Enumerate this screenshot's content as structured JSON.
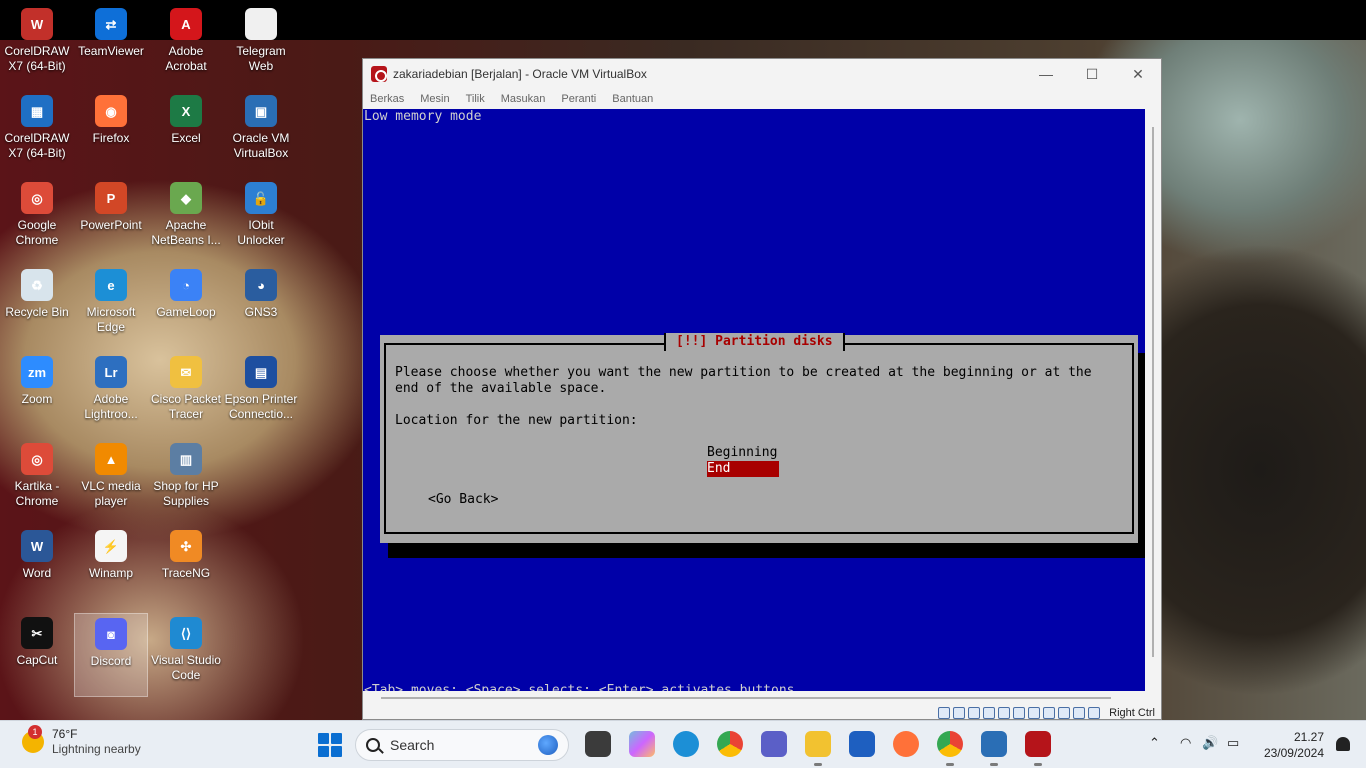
{
  "desktop": {
    "icons": [
      {
        "label": "CorelDRAW\nX7 (64-Bit)",
        "color": "#c2302a",
        "glyph": "W"
      },
      {
        "label": "TeamViewer",
        "color": "#0e6fd8",
        "glyph": "⇄"
      },
      {
        "label": "Adobe\nAcrobat",
        "color": "#d4161b",
        "glyph": "A"
      },
      {
        "label": "Telegram\nWeb",
        "color": "#f0f0f0",
        "glyph": ""
      },
      {
        "label": "CorelDRAW\nX7 (64-Bit)",
        "color": "#1f6fc4",
        "glyph": "▦"
      },
      {
        "label": "Firefox",
        "color": "#ff7139",
        "glyph": "◉"
      },
      {
        "label": "Excel",
        "color": "#1d7a45",
        "glyph": "X"
      },
      {
        "label": "Oracle VM\nVirtualBox",
        "color": "#2a6eb5",
        "glyph": "▣"
      },
      {
        "label": "Google\nChrome",
        "color": "#dd4b39",
        "glyph": "◎"
      },
      {
        "label": "PowerPoint",
        "color": "#d24726",
        "glyph": "P"
      },
      {
        "label": "Apache\nNetBeans I...",
        "color": "#6aa84f",
        "glyph": "◆"
      },
      {
        "label": "IObit\nUnlocker",
        "color": "#2d7fd3",
        "glyph": "🔓"
      },
      {
        "label": "Recycle Bin",
        "color": "#d8e4ec",
        "glyph": "♻"
      },
      {
        "label": "Microsoft\nEdge",
        "color": "#1c8fd6",
        "glyph": "e"
      },
      {
        "label": "GameLoop",
        "color": "#3b82f6",
        "glyph": "◔"
      },
      {
        "label": "GNS3",
        "color": "#2a5d9f",
        "glyph": "◕"
      },
      {
        "label": "Zoom",
        "color": "#2d8cff",
        "glyph": "zm"
      },
      {
        "label": "Adobe\nLightroo...",
        "color": "#2d6fc0",
        "glyph": "Lr"
      },
      {
        "label": "Cisco Packet\nTracer",
        "color": "#f0c040",
        "glyph": "✉"
      },
      {
        "label": "Epson Printer\nConnectio...",
        "color": "#1d4fa0",
        "glyph": "▤"
      },
      {
        "label": "Kartika -\nChrome",
        "color": "#dd4b39",
        "glyph": "◎"
      },
      {
        "label": "VLC media\nplayer",
        "color": "#f18a00",
        "glyph": "▲"
      },
      {
        "label": "Shop for HP\nSupplies",
        "color": "#5c7ea3",
        "glyph": "▥"
      },
      {
        "label": "",
        "color": "#000000",
        "glyph": ""
      },
      {
        "label": "Word",
        "color": "#2b5797",
        "glyph": "W"
      },
      {
        "label": "Winamp",
        "color": "#f5f5f5",
        "glyph": "⚡"
      },
      {
        "label": "TraceNG",
        "color": "#f08a24",
        "glyph": "✣"
      },
      {
        "label": "",
        "color": "#000000",
        "glyph": ""
      },
      {
        "label": "CapCut",
        "color": "#111111",
        "glyph": "✂"
      },
      {
        "label": "Discord",
        "color": "#5865f2",
        "glyph": "◙"
      },
      {
        "label": "Visual Studio\nCode",
        "color": "#1f8ad2",
        "glyph": "⟨⟩"
      }
    ]
  },
  "window": {
    "title": "zakariadebian [Berjalan] - Oracle VM VirtualBox",
    "minimize": "—",
    "maximize": "☐",
    "close": "✕",
    "menu": [
      "Berkas",
      "Mesin",
      "Tilik",
      "Masukan",
      "Peranti",
      "Bantuan"
    ],
    "host_key": "Right Ctrl"
  },
  "installer": {
    "mode": "Low memory mode",
    "dialog_title": "[!!] Partition disks",
    "line1": "Please choose whether you want the new partition to be created at the beginning or at the",
    "line2": "end of the available space.",
    "prompt": "Location for the new partition:",
    "options": [
      "Beginning",
      "End"
    ],
    "selected": "End",
    "go_back": "<Go Back>",
    "hint": "<Tab> moves; <Space> selects; <Enter> activates buttons"
  },
  "taskbar": {
    "weather_temp": "76°F",
    "weather_desc": "Lightning nearby",
    "weather_badge": "1",
    "search_placeholder": "Search",
    "time": "21.27",
    "date": "23/09/2024",
    "tray_chevron": "⌃",
    "tray_wifi": "◠",
    "tray_volume": "🔊",
    "tray_battery": "▭"
  },
  "colors": {
    "installer_bg": "#0000a8",
    "dialog_bg": "#aaaaaa",
    "dialog_title": "#a80000",
    "selection": "#a80000"
  }
}
